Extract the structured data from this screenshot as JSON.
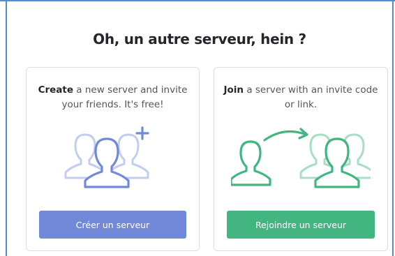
{
  "dialog": {
    "title": "Oh, un autre serveur, hein ?"
  },
  "create": {
    "lead": "Create",
    "text": " a new server and invite your friends. It's free!",
    "button_label": "Créer un serveur",
    "button_color": "#7289da",
    "icon": "add-server-people-icon"
  },
  "join": {
    "lead": "Join",
    "text": " a server with an invite code or link.",
    "button_label": "Rejoindre un serveur",
    "button_color": "#43b581",
    "icon": "join-server-people-icon"
  }
}
